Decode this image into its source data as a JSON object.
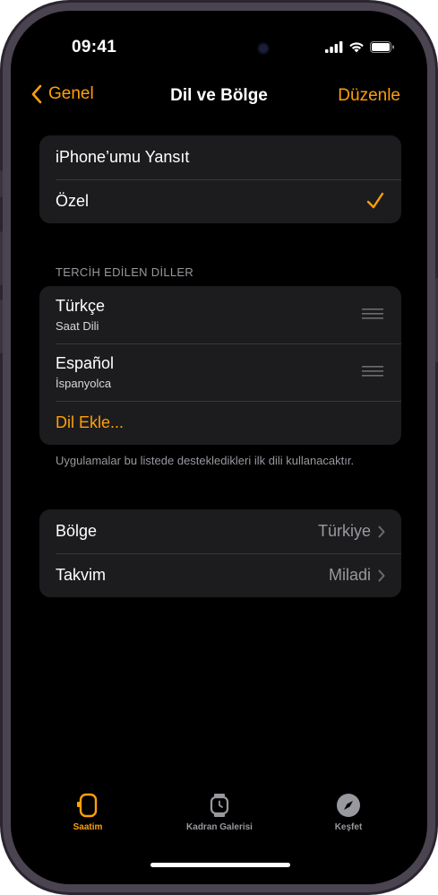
{
  "status_bar": {
    "time": "09:41"
  },
  "nav": {
    "back_label": "Genel",
    "title": "Dil ve Bölge",
    "edit_label": "Düzenle"
  },
  "mirror_group": {
    "rows": [
      {
        "label": "iPhone’umu Yansıt",
        "checked": false
      },
      {
        "label": "Özel",
        "checked": true
      }
    ]
  },
  "languages": {
    "header": "TERCİH EDİLEN DİLLER",
    "items": [
      {
        "name": "Türkçe",
        "subtitle": "Saat Dili"
      },
      {
        "name": "Español",
        "subtitle": "İspanyolca"
      }
    ],
    "add_label": "Dil Ekle...",
    "footnote": "Uygulamalar bu listede destekledikleri ilk dili kullanacaktır."
  },
  "region_group": {
    "rows": [
      {
        "label": "Bölge",
        "value": "Türkiye"
      },
      {
        "label": "Takvim",
        "value": "Miladi"
      }
    ]
  },
  "tab_bar": {
    "tabs": [
      {
        "label": "Saatim",
        "icon": "watch-side-icon",
        "active": true
      },
      {
        "label": "Kadran Galerisi",
        "icon": "watch-face-icon",
        "active": false
      },
      {
        "label": "Keşfet",
        "icon": "compass-icon",
        "active": false
      }
    ]
  },
  "colors": {
    "accent": "#ff9f0a",
    "background": "#000000",
    "cell": "#1c1c1e",
    "secondary_text": "#98989f"
  }
}
